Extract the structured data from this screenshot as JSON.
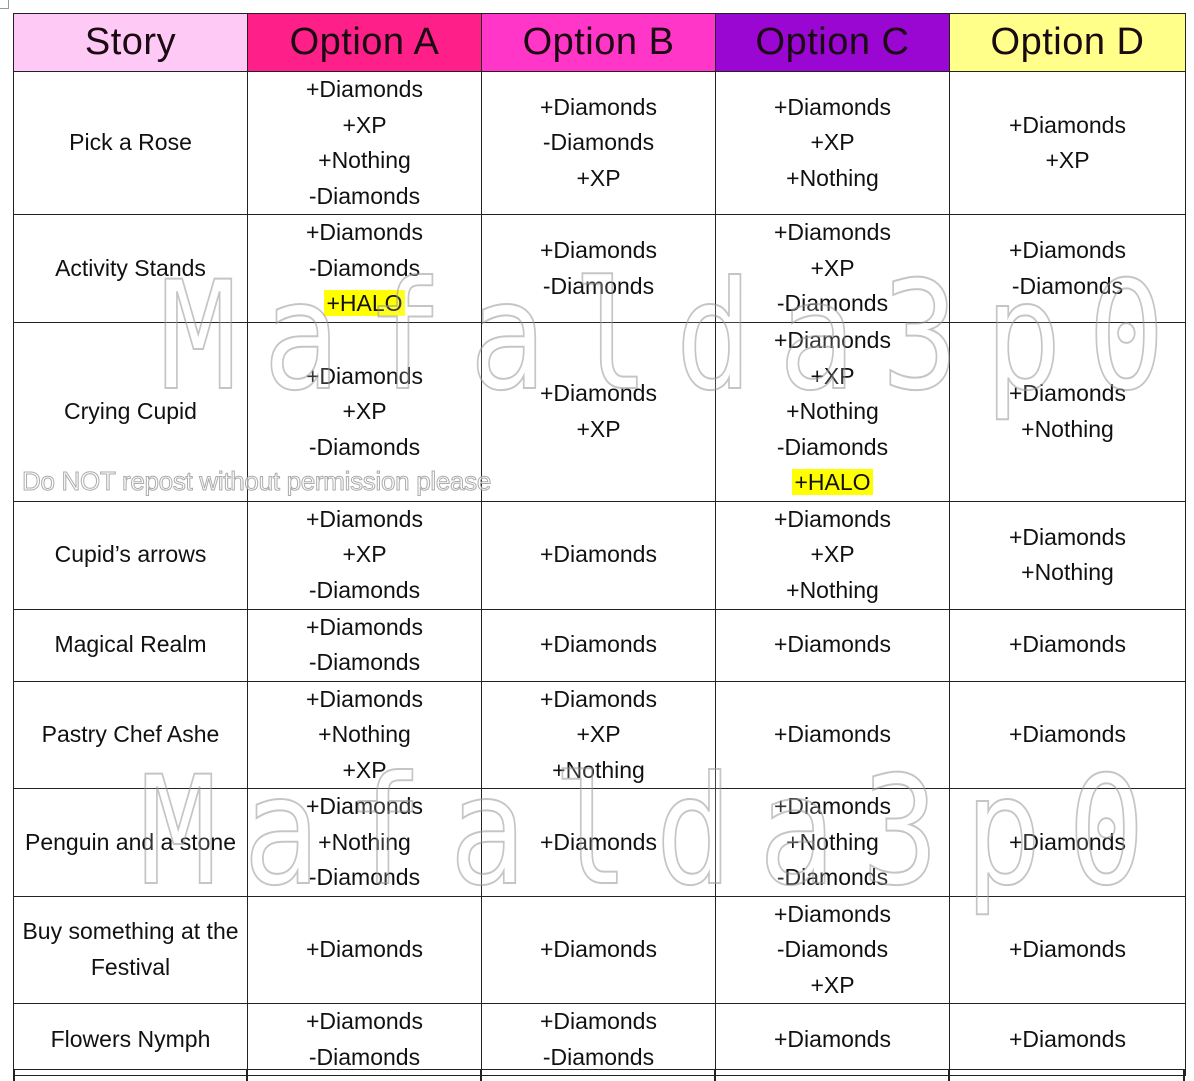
{
  "table": {
    "headers": [
      {
        "label": "Story",
        "color": "#ffc9f6"
      },
      {
        "label": "Option A",
        "color": "#ff1f88"
      },
      {
        "label": "Option B",
        "color": "#ff36c8"
      },
      {
        "label": "Option C",
        "color": "#9a06d2"
      },
      {
        "label": "Option D",
        "color": "#ffff8a"
      }
    ],
    "rows": [
      {
        "story": "Pick a Rose",
        "height": 140,
        "cells": [
          [
            "+Diamonds",
            "+XP",
            "+Nothing",
            "-Diamonds"
          ],
          [
            "+Diamonds",
            "-Diamonds",
            "+XP"
          ],
          [
            "+Diamonds",
            "+XP",
            "+Nothing"
          ],
          [
            "+Diamonds",
            "+XP"
          ]
        ]
      },
      {
        "story": "Activity Stands",
        "height": 108,
        "cells": [
          [
            "+Diamonds",
            "-Diamonds",
            "+HALO*"
          ],
          [
            "+Diamonds",
            "-Diamonds"
          ],
          [
            "+Diamonds",
            "+XP",
            "-Diamonds"
          ],
          [
            "+Diamonds",
            "-Diamonds"
          ]
        ]
      },
      {
        "story": "Crying Cupid",
        "height": 176,
        "cells": [
          [
            "+Diamonds",
            "+XP",
            "-Diamonds"
          ],
          [
            "+Diamonds",
            "+XP"
          ],
          [
            "+Diamonds",
            "+XP",
            "+Nothing",
            "-Diamonds",
            "+HALO*"
          ],
          [
            "+Diamonds",
            "+Nothing"
          ]
        ]
      },
      {
        "story": "Cupid’s arrows",
        "height": 108,
        "cells": [
          [
            "+Diamonds",
            "+XP",
            "-Diamonds"
          ],
          [
            "+Diamonds"
          ],
          [
            "+Diamonds",
            "+XP",
            "+Nothing"
          ],
          [
            "+Diamonds",
            "+Nothing"
          ]
        ]
      },
      {
        "story": "Magical Realm",
        "height": 71,
        "cells": [
          [
            "+Diamonds",
            "-Diamonds"
          ],
          [
            "+Diamonds"
          ],
          [
            "+Diamonds"
          ],
          [
            "+Diamonds"
          ]
        ]
      },
      {
        "story": "Pastry Chef Ashe",
        "height": 107,
        "cells": [
          [
            "+Diamonds",
            "+Nothing",
            "+XP"
          ],
          [
            "+Diamonds",
            "+XP",
            "+Nothing"
          ],
          [
            "+Diamonds"
          ],
          [
            "+Diamonds"
          ]
        ]
      },
      {
        "story": "Penguin and a stone",
        "height": 107,
        "cells": [
          [
            "+Diamonds",
            "+Nothing",
            "-Diamonds"
          ],
          [
            "+Diamonds"
          ],
          [
            "+Diamonds",
            "+Nothing",
            "-Diamonds"
          ],
          [
            "+Diamonds"
          ]
        ]
      },
      {
        "story": "Buy something at the Festival",
        "height": 107,
        "cells": [
          [
            "+Diamonds"
          ],
          [
            "+Diamonds"
          ],
          [
            "+Diamonds",
            "-Diamonds",
            "+XP"
          ],
          [
            "+Diamonds"
          ]
        ]
      },
      {
        "story": "Flowers Nymph",
        "height": 72,
        "cells": [
          [
            "+Diamonds",
            "-Diamonds"
          ],
          [
            "+Diamonds",
            "-Diamonds"
          ],
          [
            "+Diamonds"
          ],
          [
            "+Diamonds"
          ]
        ]
      }
    ]
  },
  "highlight_color": "#ffff00",
  "watermarks": {
    "name": "Mafalda3p0",
    "notice": "Do NOT repost without permission please"
  }
}
